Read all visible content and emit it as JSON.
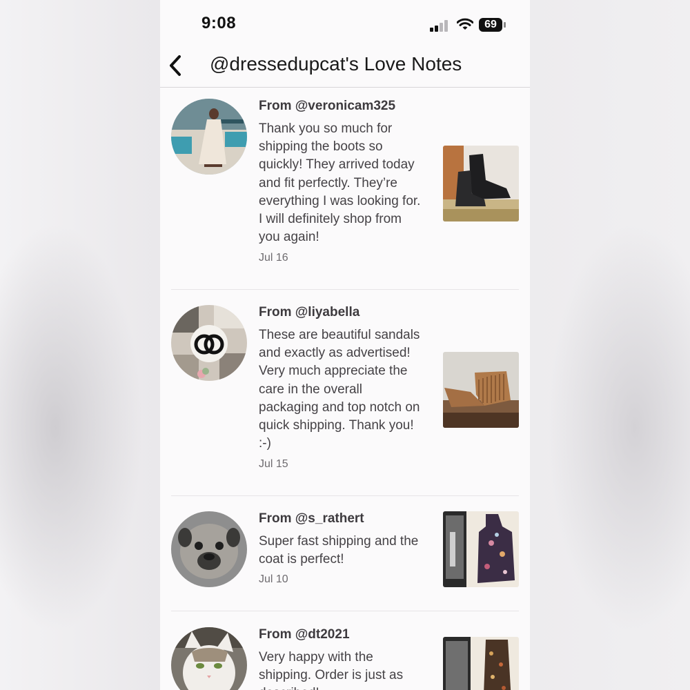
{
  "status_bar": {
    "time": "9:08",
    "battery_level": "69"
  },
  "header": {
    "back_icon": "chevron-left-icon",
    "title": "@dressedupcat's Love Notes"
  },
  "notes": [
    {
      "from_prefix": "From ",
      "from_handle": "@veronicam325",
      "message": "Thank you so much for shipping the boots so quickly! They arrived today and fit perfectly. They’re everything I was looking for. I will definitely shop from you again!",
      "date": "Jul 16",
      "avatar": "woman-in-white-dress-photo",
      "item": "black-ankle-boots-photo"
    },
    {
      "from_prefix": "From ",
      "from_handle": "@liyabella",
      "message": "These are beautiful sandals and exactly as advertised! Very much appreciate the care in the overall packaging and top notch on quick shipping. Thank you! :-)",
      "date": "Jul 15",
      "avatar": "chanel-logo-collage",
      "item": "tan-fringe-sandals-photo"
    },
    {
      "from_prefix": "From ",
      "from_handle": "@s_rathert",
      "message": "Super fast shipping and the coat is perfect!",
      "date": "Jul 10",
      "avatar": "pug-face-photo",
      "item": "floral-coat-photo"
    },
    {
      "from_prefix": "From ",
      "from_handle": "@dt2021",
      "message": "Very happy with the shipping. Order is just as described!",
      "date": "",
      "avatar": "white-cat-photo",
      "item": "floral-pants-photo"
    }
  ]
}
